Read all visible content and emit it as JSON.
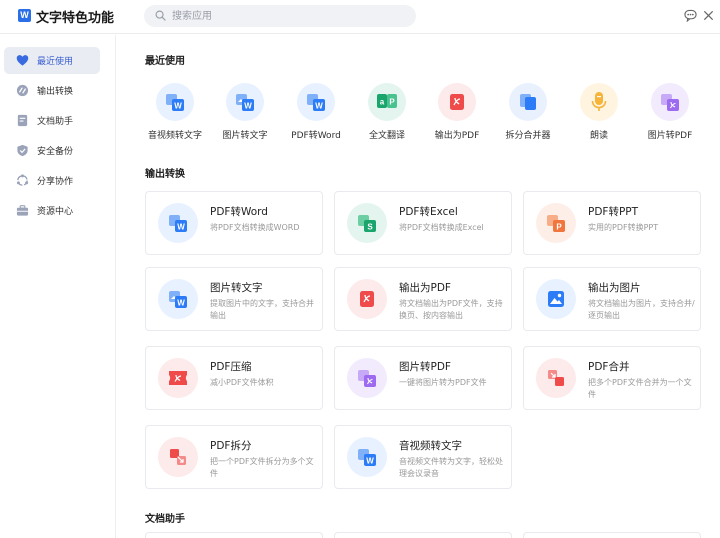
{
  "header": {
    "title": "文字特色功能",
    "logo_letter": "W",
    "search_placeholder": "搜索应用"
  },
  "sidebar": {
    "items": [
      {
        "label": "最近使用",
        "icon": "heart-icon",
        "active": true
      },
      {
        "label": "输出转换",
        "icon": "convert-icon",
        "active": false
      },
      {
        "label": "文档助手",
        "icon": "document-icon",
        "active": false
      },
      {
        "label": "安全备份",
        "icon": "shield-icon",
        "active": false
      },
      {
        "label": "分享协作",
        "icon": "share-icon",
        "active": false
      },
      {
        "label": "资源中心",
        "icon": "briefcase-icon",
        "active": false
      }
    ]
  },
  "sections": {
    "recent": "最近使用",
    "output": "输出转换",
    "assistant": "文档助手"
  },
  "recent": [
    {
      "label": "音视频转文字",
      "icon": "audio-to-text-icon"
    },
    {
      "label": "图片转文字",
      "icon": "image-to-text-icon"
    },
    {
      "label": "PDF转Word",
      "icon": "pdf-to-word-icon"
    },
    {
      "label": "全文翻译",
      "icon": "translate-icon"
    },
    {
      "label": "输出为PDF",
      "icon": "export-pdf-icon"
    },
    {
      "label": "拆分合并器",
      "icon": "split-merge-icon"
    },
    {
      "label": "朗读",
      "icon": "microphone-icon"
    },
    {
      "label": "图片转PDF",
      "icon": "image-to-pdf-icon"
    }
  ],
  "cards": [
    {
      "title": "PDF转Word",
      "desc": "将PDF文档转换成WORD",
      "icon": "pdf-to-word-icon"
    },
    {
      "title": "PDF转Excel",
      "desc": "将PDF文档转换成Excel",
      "icon": "pdf-to-excel-icon"
    },
    {
      "title": "PDF转PPT",
      "desc": "实用的PDF转换PPT",
      "icon": "pdf-to-ppt-icon"
    },
    {
      "title": "图片转文字",
      "desc": "提取图片中的文字，支持合并输出",
      "icon": "image-to-text-icon"
    },
    {
      "title": "输出为PDF",
      "desc": "将文档输出为PDF文件，支持换页、按内容输出",
      "icon": "export-pdf-icon"
    },
    {
      "title": "输出为图片",
      "desc": "将文档输出为图片，支持合并/逐页输出",
      "icon": "export-image-icon"
    },
    {
      "title": "PDF压缩",
      "desc": "减小PDF文件体积",
      "icon": "pdf-compress-icon"
    },
    {
      "title": "图片转PDF",
      "desc": "一键将图片转为PDF文件",
      "icon": "image-to-pdf-icon"
    },
    {
      "title": "PDF合并",
      "desc": "把多个PDF文件合并为一个文件",
      "icon": "pdf-merge-icon"
    },
    {
      "title": "PDF拆分",
      "desc": "把一个PDF文件拆分为多个文件",
      "icon": "pdf-split-icon"
    },
    {
      "title": "音视频转文字",
      "desc": "音视频文件转为文字，轻松处理会议录音",
      "icon": "audio-to-text-icon"
    }
  ],
  "colors": {
    "accent": "#2a6ee8",
    "word_blue": "#2b7cf6",
    "excel_green": "#1aa56c",
    "ppt_orange": "#f0763e",
    "pdf_red": "#ef4b4b",
    "purple": "#9d6bf0",
    "yellow": "#f6b53a"
  }
}
